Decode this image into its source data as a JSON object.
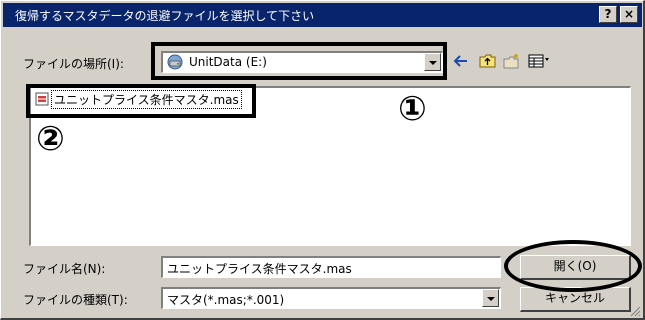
{
  "dialog": {
    "title": "復帰するマスタデータの退避ファイルを選択して下さい",
    "help_button": "?",
    "close_button": "×"
  },
  "location": {
    "label": "ファイルの場所(I):",
    "value": "UnitData (E:)"
  },
  "file_list": {
    "items": [
      {
        "name": "ユニットプライス条件マスタ.mas"
      }
    ]
  },
  "filename": {
    "label": "ファイル名(N):",
    "value": "ユニットプライス条件マスタ.mas"
  },
  "filetype": {
    "label": "ファイルの種類(T):",
    "value": "マスタ(*.mas;*.001)"
  },
  "buttons": {
    "open": "開く(O)",
    "cancel": "キャンセル"
  },
  "annotations": {
    "marker_1": "①",
    "marker_2": "②"
  },
  "toolbar_icons": [
    "back-arrow-icon",
    "up-folder-icon",
    "new-folder-icon",
    "view-menu-icon"
  ],
  "colors": {
    "titlebar": "#08246b",
    "face": "#d4d0c8"
  }
}
